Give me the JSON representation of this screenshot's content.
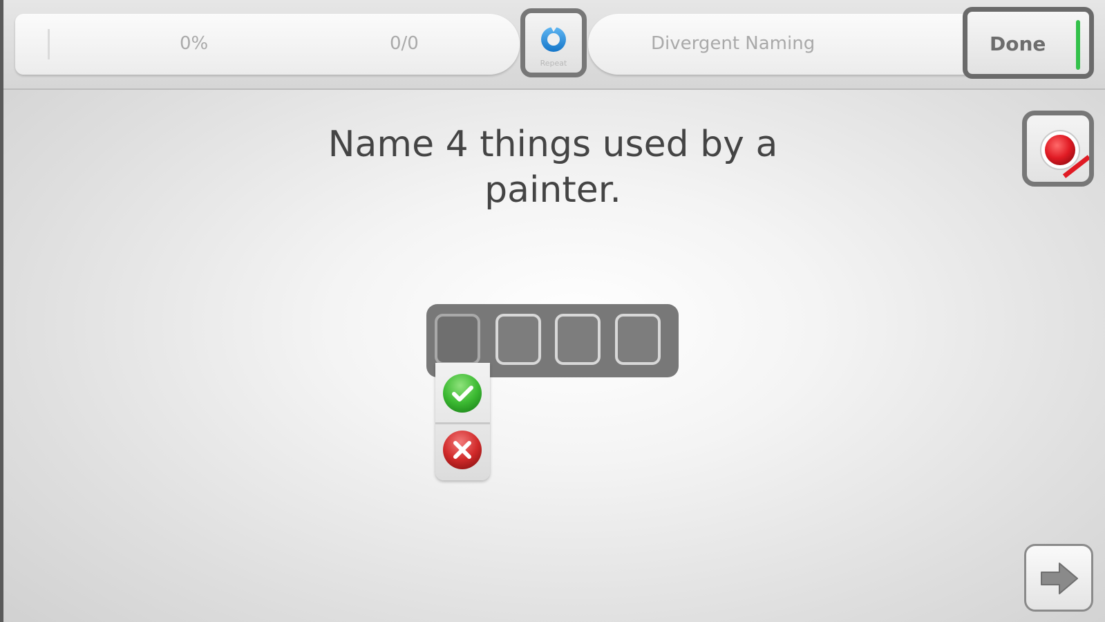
{
  "header": {
    "progress_percent_label": "0%",
    "progress_percent": 0,
    "item_count_label": "0/0",
    "repeat_label": "Repeat",
    "module_title": "Divergent Naming",
    "done_label": "Done"
  },
  "task": {
    "prompt": "Name 4 things used by a painter.",
    "answer_slots": [
      {
        "filled": false,
        "selected": true
      },
      {
        "filled": false,
        "selected": false
      },
      {
        "filled": false,
        "selected": false
      },
      {
        "filled": false,
        "selected": false
      }
    ]
  },
  "colors": {
    "repeat_icon": "#1f8fe0",
    "done_indicator": "#33c14a",
    "record": "#e01b24",
    "correct": "#3cba32",
    "wrong": "#d12a2a"
  },
  "icons": {
    "repeat": "repeat-icon",
    "record": "record-icon",
    "correct": "check-icon",
    "wrong": "x-icon",
    "next": "arrow-right-icon"
  }
}
